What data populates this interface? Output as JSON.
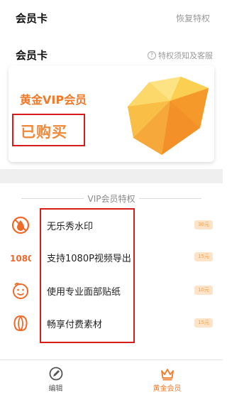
{
  "topbar": {
    "title": "会员卡",
    "restore": "恢复特权"
  },
  "section": {
    "title": "会员卡",
    "help_label": "特权须知及客服"
  },
  "card": {
    "vip_name": "黄金VIP会员",
    "status": "已购买"
  },
  "privileges": {
    "title": "VIP会员特权",
    "items": [
      {
        "label": "无乐秀水印",
        "tag": "30元",
        "icon": "no-watermark-icon"
      },
      {
        "label": "支持1080P视频导出",
        "tag": "15元",
        "icon": "1080-icon"
      },
      {
        "label": "使用专业面部贴纸",
        "tag": "10元",
        "icon": "face-sticker-icon"
      },
      {
        "label": "畅享付费素材",
        "tag": "15元",
        "icon": "materials-icon"
      }
    ]
  },
  "tabs": [
    {
      "label": "编辑",
      "icon": "edit-icon"
    },
    {
      "label": "黄金会员",
      "icon": "crown-icon"
    }
  ],
  "colors": {
    "accent": "#ef7a2a",
    "highlight_border": "#d81b1b",
    "tag_bg": "#fde4c8"
  }
}
